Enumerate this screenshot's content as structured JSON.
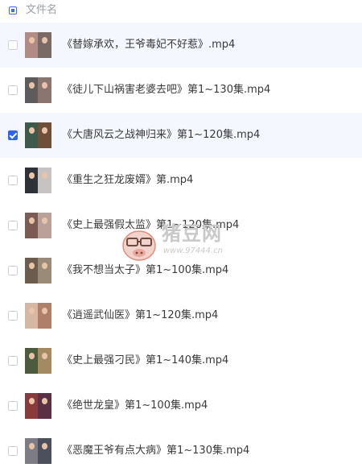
{
  "header": {
    "label": "文件名"
  },
  "colors": {
    "accent": "#2f63f0",
    "row_highlight": "#f5f7ff"
  },
  "files": [
    {
      "name": "《替嫁承欢，王爷毒妃不好惹》.mp4",
      "checked": false,
      "highlighted": true,
      "thumb": [
        "#b08c84",
        "#7a6a66"
      ]
    },
    {
      "name": "《徒儿下山祸害老婆去吧》第1~130集.mp4",
      "checked": false,
      "highlighted": false,
      "thumb": [
        "#5e5b5c",
        "#8a7570"
      ]
    },
    {
      "name": "《大唐风云之战神归来》第1~120集.mp4",
      "checked": true,
      "highlighted": true,
      "thumb": [
        "#3e5a4a",
        "#6f4e3a"
      ]
    },
    {
      "name": "《重生之狂龙废婿》第.mp4",
      "checked": false,
      "highlighted": false,
      "thumb": [
        "#2e3238",
        "#c7c3c2"
      ]
    },
    {
      "name": "《史上最强假太监》第1~120集.mp4",
      "checked": false,
      "highlighted": false,
      "thumb": [
        "#7c5b55",
        "#b9a19a"
      ]
    },
    {
      "name": "《我不想当太子》第1~100集.mp4",
      "checked": false,
      "highlighted": false,
      "thumb": [
        "#6b5c4d",
        "#9a8a78"
      ]
    },
    {
      "name": "《逍遥武仙医》第1~120集.mp4",
      "checked": false,
      "highlighted": false,
      "thumb": [
        "#d8b6a4",
        "#b07f6a"
      ]
    },
    {
      "name": "《史上最强刁民》第1~140集.mp4",
      "checked": false,
      "highlighted": false,
      "thumb": [
        "#4a5b3e",
        "#a38a62"
      ]
    },
    {
      "name": "《绝世龙皇》第1~100集.mp4",
      "checked": false,
      "highlighted": false,
      "thumb": [
        "#8a3a3a",
        "#5b3044"
      ]
    },
    {
      "name": "《恶魔王爷有点大病》第1~130集.mp4",
      "checked": false,
      "highlighted": false,
      "thumb": [
        "#7d7b83",
        "#4c4f5c"
      ]
    }
  ],
  "watermark": {
    "text": "猪豆网",
    "url": "www.97444.cn"
  }
}
